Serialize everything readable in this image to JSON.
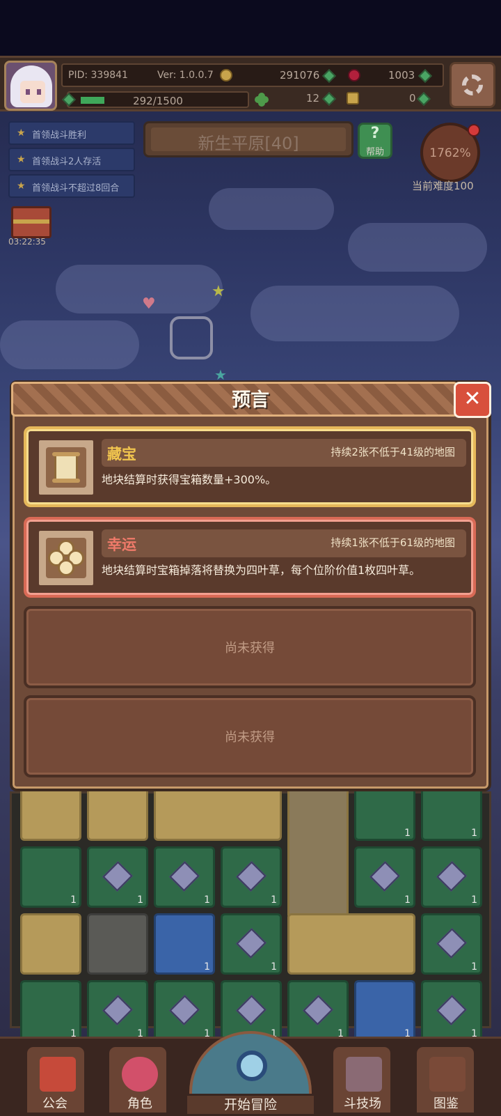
{
  "hud": {
    "pid": "PID: 339841",
    "version": "Ver: 1.0.0.7",
    "gold": "291076",
    "rubies": "1003",
    "xp": "292/1500",
    "clovers": "12",
    "keys": "0"
  },
  "quests": [
    {
      "label": "首领战斗胜利"
    },
    {
      "label": "首领战斗2人存活"
    },
    {
      "label": "首领战斗不超过8回合"
    }
  ],
  "map": {
    "title": "新生平原[40]",
    "help_label": "帮助",
    "help_symbol": "?"
  },
  "difficulty": {
    "value": "1762%",
    "label": "当前难度100"
  },
  "chest": {
    "timer": "03:22:35"
  },
  "modal": {
    "title": "预言",
    "close_symbol": "✕",
    "cards": [
      {
        "name": "藏宝",
        "condition": "持续2张不低于41级的地图",
        "description": "地块结算时获得宝箱数量+300%。"
      },
      {
        "name": "幸运",
        "condition": "持续1张不低于61级的地图",
        "description": "地块结算时宝箱掉落将替换为四叶草，每个位阶价值1枚四叶草。"
      }
    ],
    "empty_slots": [
      {
        "label": "尚未获得"
      },
      {
        "label": "尚未获得"
      }
    ]
  },
  "board": {
    "counts": [
      "1",
      "1",
      "1",
      "1",
      "1",
      "1",
      "1",
      "1",
      "1",
      "1",
      "1",
      "1",
      "1",
      "1",
      "1",
      "1",
      "1",
      "1",
      "1"
    ]
  },
  "nav": {
    "guild": "公会",
    "character": "角色",
    "start": "开始冒险",
    "arena": "斗技场",
    "codex": "图鉴"
  },
  "colors": {
    "gold_card_border": "#e6b85a",
    "red_card_border": "#d96a56",
    "close_button": "#d8503c"
  }
}
